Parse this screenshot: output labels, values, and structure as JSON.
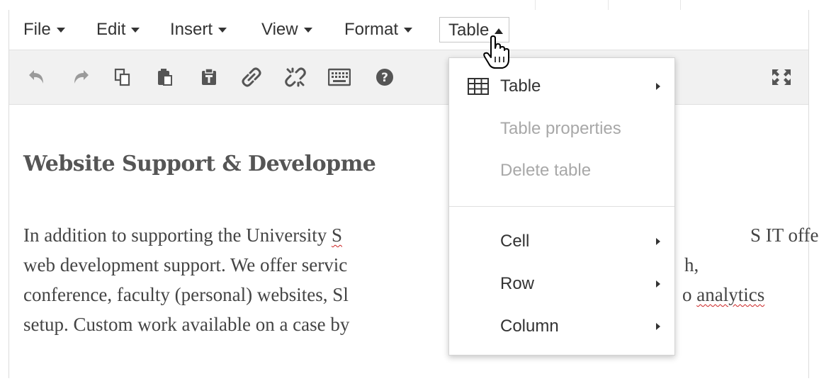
{
  "menubar": {
    "items": [
      {
        "label": "File"
      },
      {
        "label": "Edit"
      },
      {
        "label": "Insert"
      },
      {
        "label": "View"
      },
      {
        "label": "Format"
      },
      {
        "label": "Table"
      }
    ]
  },
  "toolbar": {
    "buttons": [
      "undo-icon",
      "redo-icon",
      "copy-icon",
      "paste-icon",
      "paste-as-text-icon",
      "insert-link-icon",
      "unlink-icon",
      "keyboard-shortcuts-icon",
      "help-icon",
      "fullscreen-icon"
    ]
  },
  "content": {
    "heading": "Website Support & Developme",
    "paragraph_lines": [
      {
        "start": "In addition to supporting the University ",
        "misspelled": "S",
        "end": "S IT offers"
      },
      {
        "start": "web development support. We offer servic",
        "end": "h,"
      },
      {
        "start": "conference, faculty (personal) websites, Sl",
        "end": "o ",
        "misspelled_end": "analytics"
      },
      {
        "start": "setup. Custom work available on a case by",
        "end": ""
      }
    ]
  },
  "dropdown": {
    "items": [
      {
        "label": "Table",
        "icon": "table-grid-icon",
        "submenu": true,
        "disabled": false
      },
      {
        "label": "Table properties",
        "disabled": true
      },
      {
        "label": "Delete table",
        "disabled": true
      },
      {
        "label": "Cell",
        "submenu": true,
        "disabled": false
      },
      {
        "label": "Row",
        "submenu": true,
        "disabled": false
      },
      {
        "label": "Column",
        "submenu": true,
        "disabled": false
      }
    ]
  },
  "colors": {
    "toolbar_bg": "#f1f1f1",
    "text": "#333333",
    "disabled_text": "#a8a8a8",
    "spellcheck": "#cc2222"
  }
}
